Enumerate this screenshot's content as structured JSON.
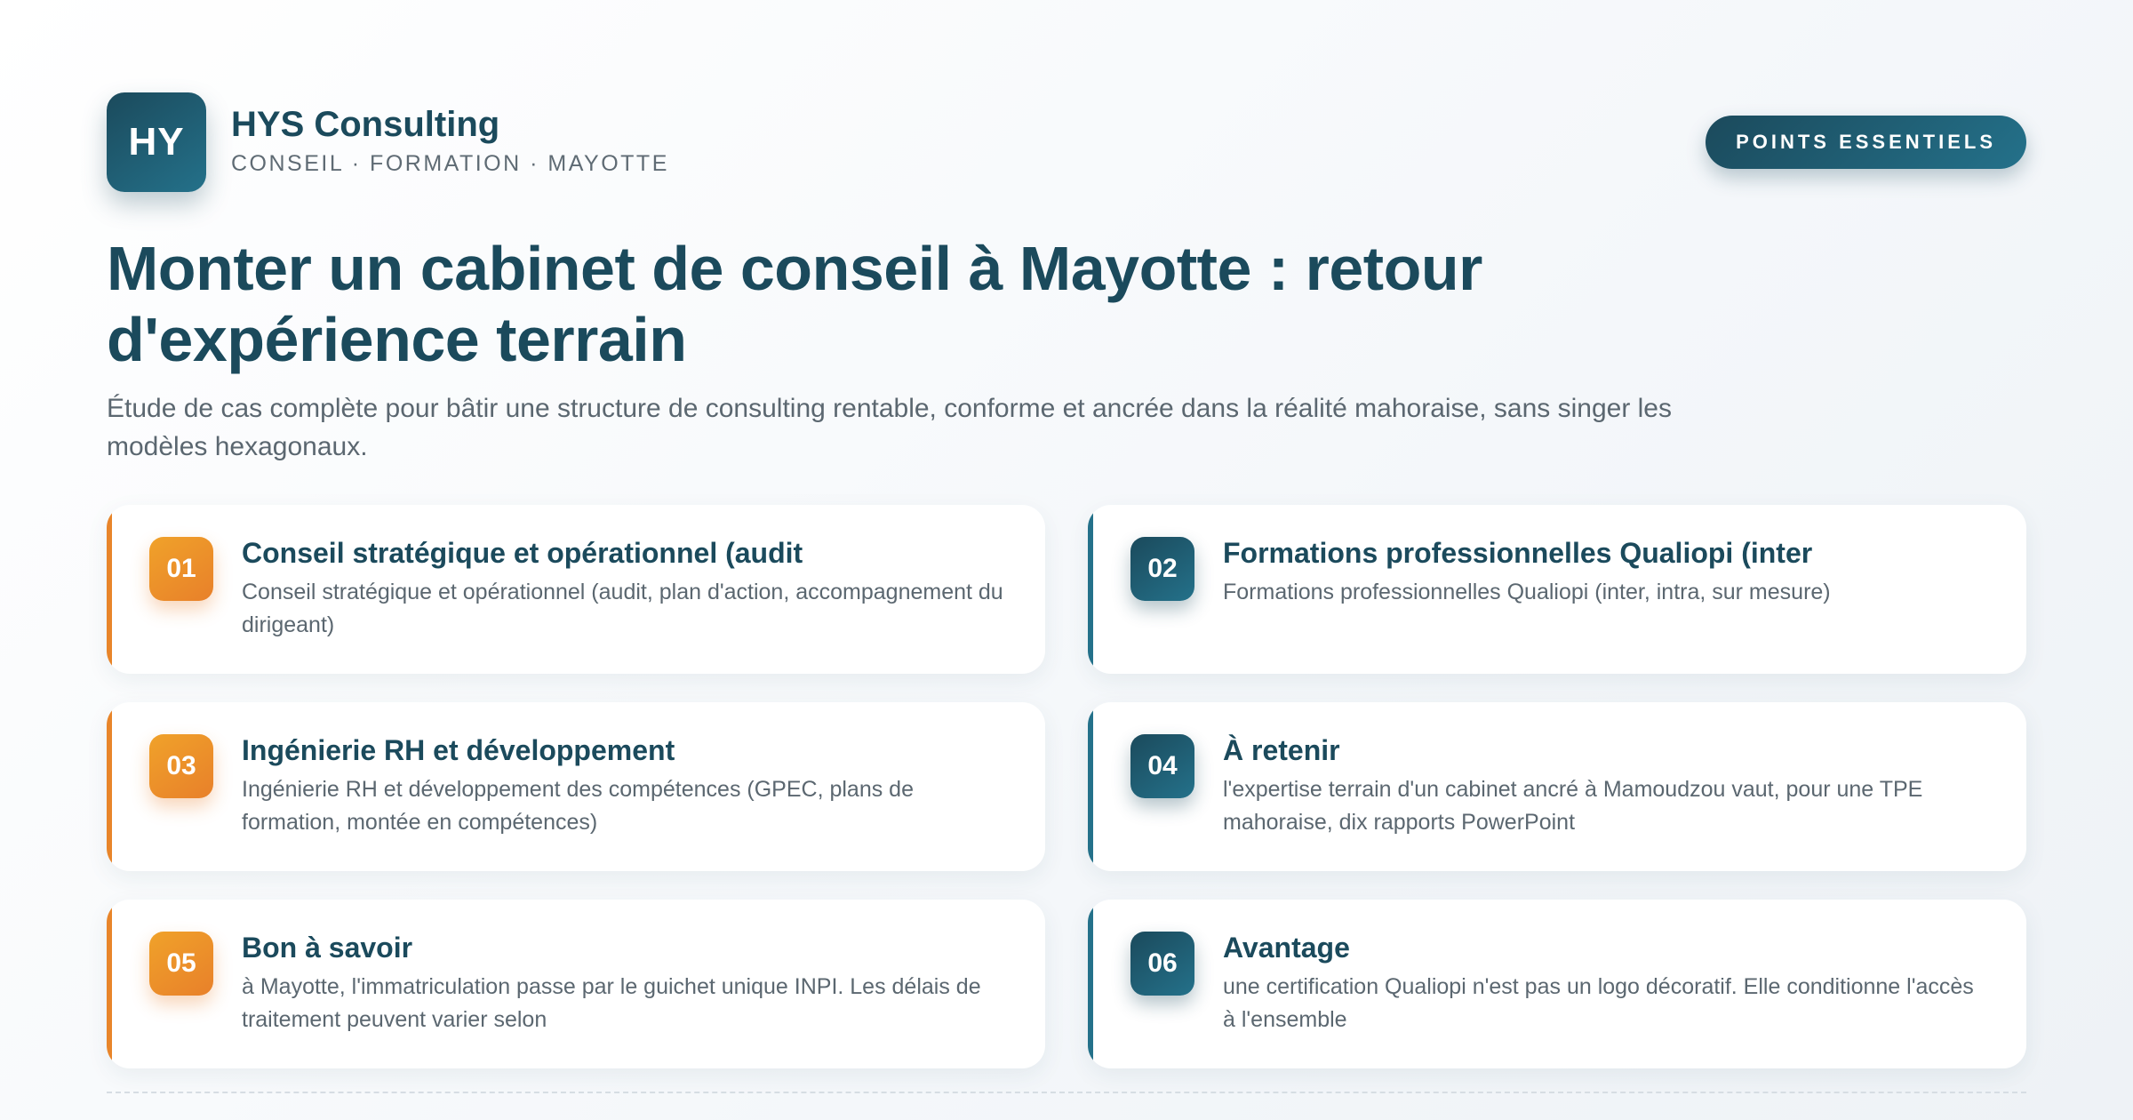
{
  "brand": {
    "initials": "HY",
    "name": "HYS Consulting",
    "tagline": "CONSEIL · FORMATION · MAYOTTE"
  },
  "badge_label": "POINTS ESSENTIELS",
  "title": "Monter un cabinet de conseil à Mayotte : retour d'expérience terrain",
  "subtitle": "Étude de cas complète pour bâtir une structure de consulting rentable, conforme et ancrée dans la réalité mahoraise, sans singer les modèles hexagonaux.",
  "cards": [
    {
      "number": "01",
      "title": "Conseil stratégique et opérationnel (audit",
      "body": "Conseil stratégique et opérationnel (audit, plan d'action, accompagnement du dirigeant)",
      "accent": "#e8852a"
    },
    {
      "number": "02",
      "title": "Formations professionnelles Qualiopi (inter",
      "body": "Formations professionnelles Qualiopi (inter, intra, sur mesure)",
      "accent": "#24718a"
    },
    {
      "number": "03",
      "title": "Ingénierie RH et développement",
      "body": "Ingénierie RH et développement des compétences (GPEC, plans de formation, montée en compétences)",
      "accent": "#e8852a"
    },
    {
      "number": "04",
      "title": "À retenir",
      "body": "l'expertise terrain d'un cabinet ancré à Mamoudzou vaut, pour une TPE mahoraise, dix rapports PowerPoint",
      "accent": "#24718a"
    },
    {
      "number": "05",
      "title": "Bon à savoir",
      "body": "à Mayotte, l'immatriculation passe par le guichet unique INPI. Les délais de traitement peuvent varier selon",
      "accent": "#e8852a"
    },
    {
      "number": "06",
      "title": "Avantage",
      "body": "une certification Qualiopi n'est pas un logo décoratif. Elle conditionne l'accès à l'ensemble",
      "accent": "#24718a"
    }
  ],
  "colors": {
    "primary": "#1b4a5c",
    "teal": "#24718a",
    "orange": "#e8852a",
    "text_muted": "#5b6770"
  }
}
